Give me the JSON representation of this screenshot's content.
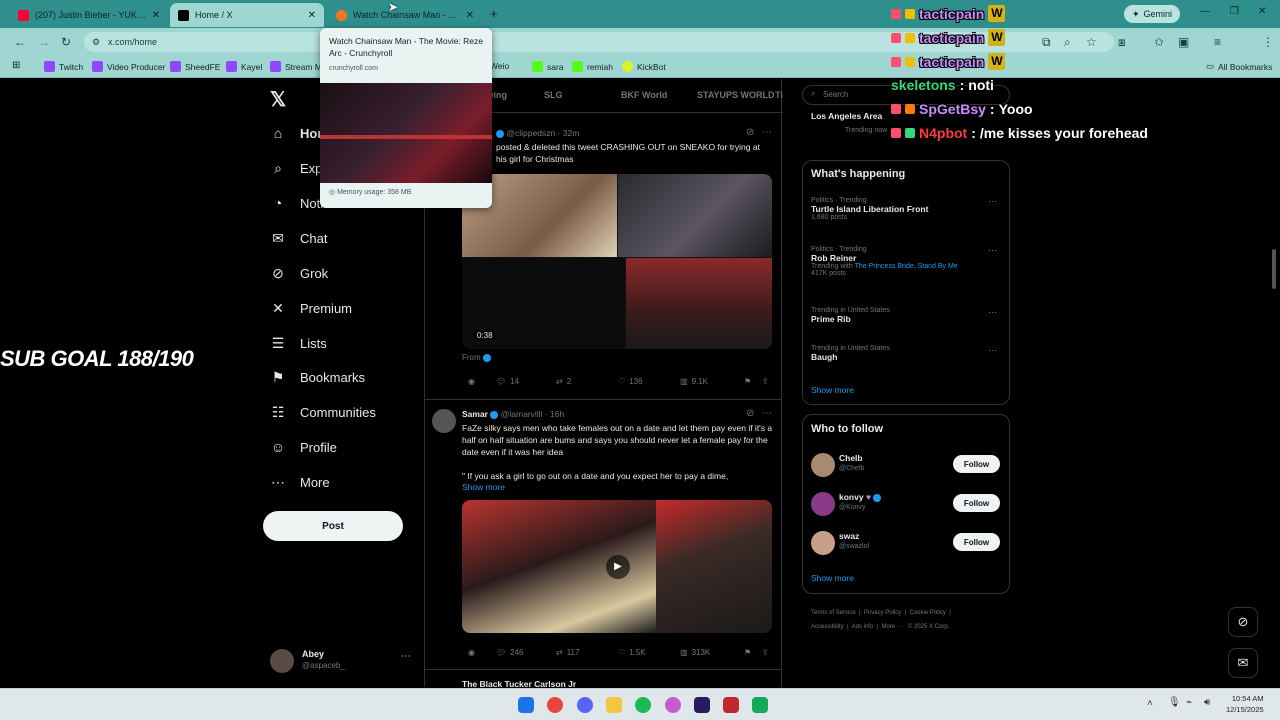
{
  "browser": {
    "tabs": [
      {
        "title": "(207) Justin Bieber - YUKON - Yo",
        "favicon_color": "#ff0033"
      },
      {
        "title": "Home / X",
        "favicon_color": "#000000"
      },
      {
        "title": "Watch Chainsaw Man - The Movie",
        "favicon_color": "#f47521"
      }
    ],
    "gemini_label": "Gemini",
    "url": "x.com/home",
    "bookmarks": [
      "Twitch",
      "Video Producer",
      "SheedFE",
      "Kayel",
      "Stream M",
      "Weio",
      "sara",
      "remiah",
      "KickBot"
    ],
    "all_bookmarks_label": "All Bookmarks",
    "tab_hover": {
      "title": "Watch Chainsaw Man - The Movie: Reze Arc - Crunchyroll",
      "domain": "crunchyroll.com",
      "memory": "Memory usage: 358 MB"
    }
  },
  "x_nav": {
    "items": [
      {
        "label": "Home",
        "icon": "home-icon",
        "glyph": "⌂"
      },
      {
        "label": "Explore",
        "icon": "search-icon",
        "glyph": "⌕"
      },
      {
        "label": "Notifications",
        "icon": "bell-icon",
        "glyph": "◔"
      },
      {
        "label": "Chat",
        "icon": "mail-icon",
        "glyph": "✉"
      },
      {
        "label": "Grok",
        "icon": "grok-icon",
        "glyph": "⊘"
      },
      {
        "label": "Premium",
        "icon": "x-icon",
        "glyph": "✕"
      },
      {
        "label": "Lists",
        "icon": "list-icon",
        "glyph": "☰"
      },
      {
        "label": "Bookmarks",
        "icon": "bookmark-icon",
        "glyph": "⚑"
      },
      {
        "label": "Communities",
        "icon": "people-icon",
        "glyph": "☷"
      },
      {
        "label": "Profile",
        "icon": "person-icon",
        "glyph": "☺"
      },
      {
        "label": "More",
        "icon": "more-icon",
        "glyph": "⋯"
      }
    ],
    "post_label": "Post",
    "account": {
      "name": "Abey",
      "handle": "@aspaceb_"
    }
  },
  "feed": {
    "tabs": [
      "Following",
      "SLG",
      "BKF World",
      "STAYUPS WORLD",
      "Ti"
    ],
    "tweet1": {
      "handle": "@clippedszn",
      "time": "32m",
      "text": "posted & deleted this tweet CRASHING OUT on SNEAKO for trying at his girl for Christmas",
      "video_time": "0:38",
      "from_label": "From",
      "stats": {
        "replies": "14",
        "reposts": "2",
        "likes": "136",
        "views": "9.1K"
      }
    },
    "tweet2": {
      "name": "Samar",
      "handle": "@lamarvilll",
      "time": "16h",
      "text": "FaZe silky says men who take females out on a date and let them pay even if it's a half on half situation are bums and says you should never let a female pay for the date even if it was her idea",
      "quote": "\" If you ask a girl to go out on a date and you expect her to pay a dime,",
      "show_more": "Show more",
      "stats": {
        "replies": "246",
        "reposts": "117",
        "likes": "1.5K",
        "views": "313K"
      }
    },
    "tweet3_name": "The Black Tucker Carlson Jr"
  },
  "sidebar": {
    "search_placeholder": "Search",
    "top_trend": "Los Angeles Area",
    "top_trend_sub": "Trending now",
    "whats_happening": "What's happening",
    "trends": [
      {
        "category": "Politics · Trending",
        "name": "Turtle Island Liberation Front",
        "posts": "1,680 posts"
      },
      {
        "category": "Politics · Trending",
        "name": "Rob Reiner",
        "related_prefix": "Trending with",
        "related": "The Princess Bride, Stand By Me",
        "posts": "417K posts"
      },
      {
        "category": "Trending in United States",
        "name": "Prime Rib",
        "posts": ""
      },
      {
        "category": "Trending in United States",
        "name": "Baugh",
        "posts": ""
      }
    ],
    "show_more": "Show more",
    "who_to_follow": "Who to follow",
    "follows": [
      {
        "name": "Chelb",
        "handle": "@Chelb"
      },
      {
        "name": "konvy",
        "handle": "@Konvy"
      },
      {
        "name": "swaz",
        "handle": "@swazlol"
      }
    ],
    "follow_label": "Follow",
    "footer": [
      "Terms of Service",
      "Privacy Policy",
      "Cookie Policy",
      "Accessibility",
      "Ads info",
      "More ···",
      "© 2025 X Corp."
    ]
  },
  "overlay": {
    "sub_goal": "SUB GOAL 188/190",
    "chat": [
      {
        "user": "tacticpain",
        "msg": "",
        "color": "#c98bff"
      },
      {
        "user": "tacticpain",
        "msg": "",
        "color": "#c98bff"
      },
      {
        "user": "tacticpain",
        "msg": "",
        "color": "#c98bff"
      },
      {
        "user": "skeletons",
        "msg": "noti",
        "color": "#37d67a"
      },
      {
        "user": "SpGetBsy",
        "msg": "Yooo",
        "color": "#c98bff"
      },
      {
        "user": "N4pbot",
        "msg": "/me kisses your forehead",
        "color": "#ff3b3b"
      }
    ]
  },
  "taskbar": {
    "time": "10:54 AM",
    "date": "12/15/2025"
  }
}
